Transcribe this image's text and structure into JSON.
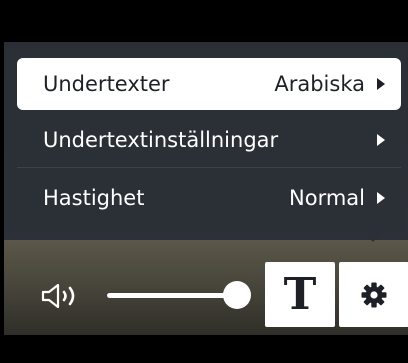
{
  "menu": {
    "items": [
      {
        "label": "Undertexter",
        "value": "Arabiska",
        "selected": true
      },
      {
        "label": "Undertextinställningar",
        "value": "",
        "selected": false
      },
      {
        "label": "Hastighet",
        "value": "Normal",
        "selected": false
      }
    ]
  },
  "controls": {
    "volume_level": 1.0,
    "captions_glyph": "T",
    "icons": [
      "speaker-icon",
      "captions-icon",
      "gear-icon",
      "chevron-right-icon"
    ]
  },
  "colors": {
    "menu_bg": "#2b2f36",
    "selected_bg": "#ffffff",
    "text": "#ffffff",
    "selected_text": "#1d2127"
  }
}
